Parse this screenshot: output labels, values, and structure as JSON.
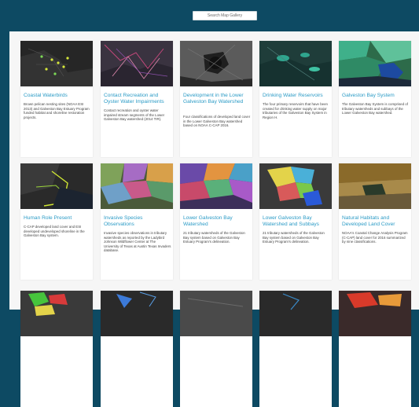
{
  "search": {
    "placeholder": "Search Map Gallery"
  },
  "colors": {
    "header": "#0d4a63",
    "panel": "#f6f6f6",
    "title_link": "#2b9bc6"
  },
  "cards": [
    {
      "title": "Coastal Waterbirds",
      "desc": "Brown pelican nesting sites (NOAA ESI 2013) and Galveston Bay Estuary Program funded habitat and shoreline restoration projects."
    },
    {
      "title": "Contact Recreation and Oyster Water Impairments",
      "desc": "Contact recreation and oyster water impaired stream segments of the Lower Galveston Bay watershed (2014 TIR)."
    },
    {
      "title": "Development in the Lower Galveston Bay Watershed",
      "desc": "Four classifications of developed land cover in the Lower Galveston Bay watershed based on NOAA C-CAP 2016."
    },
    {
      "title": "Drinking Water Reservoirs",
      "desc": "The four primary reservoirs that have been created for drinking water supply on major tributaries of the Galveston Bay System in Region H."
    },
    {
      "title": "Galveston Bay System",
      "desc": "The Galveston Bay System is comprised of tributary watersheds and subbays of the Lower Galveston Bay watershed."
    },
    {
      "title": "Human Role Present",
      "desc": "C-CAP developed land cover and ESI developed undeveloped shoreline in the Galveston Bay system."
    },
    {
      "title": "Invasive Species Observations",
      "desc": "Invasive species observations in tributary watersheds as reported by the Ladybird Johnson Wildflower Center at The University of Texas at Austin Texas Invaders database."
    },
    {
      "title": "Lower Galveston Bay Watershed",
      "desc": "21 tributary watersheds of the Galveston Bay system based on Galveston Bay Estuary Program's delineation."
    },
    {
      "title": "Lower Galveston Bay Watershed and Subbays",
      "desc": "21 tributary watersheds of the Galveston Bay system based on Galveston Bay Estuary Program's delineation."
    },
    {
      "title": "Natural Habitats and Developed Land Cover",
      "desc": "NOAA's Coastal Change Analysis Program (C-CAP) land cover for 2016 summarized by nine classifications."
    }
  ],
  "thumbs": [
    {
      "icon": "coastal-waterbirds-map-thumbnail",
      "base": "#262626",
      "accent": "#d6e83b"
    },
    {
      "icon": "contact-recreation-map-thumbnail",
      "base": "#3a3340",
      "accent": "#c2477a"
    },
    {
      "icon": "development-map-thumbnail",
      "base": "#5b5b5b",
      "accent": "#1f1f1f"
    },
    {
      "icon": "drinking-water-reservoirs-map-thumbnail",
      "base": "#1f3d3a",
      "accent": "#2fa58e"
    },
    {
      "icon": "galveston-bay-system-map-thumbnail",
      "base": "#2d6b4a",
      "accent": "#3fb08a"
    },
    {
      "icon": "human-role-present-map-thumbnail",
      "base": "#2a2a2a",
      "accent": "#cfe633"
    },
    {
      "icon": "invasive-species-map-thumbnail",
      "base": "#4a5a3a",
      "accent": "#a66cc4"
    },
    {
      "icon": "lower-galveston-bay-watershed-map-thumbnail",
      "base": "#3c2f5a",
      "accent": "#e39440"
    },
    {
      "icon": "watershed-and-subbays-map-thumbnail",
      "base": "#3a3a3a",
      "accent": "#e3d34a"
    },
    {
      "icon": "natural-habitats-map-thumbnail",
      "base": "#5c4a2a",
      "accent": "#8a6a2a"
    },
    {
      "icon": "row3-thumbnail-1",
      "base": "#3a3a3a",
      "accent": "#46c43c"
    },
    {
      "icon": "row3-thumbnail-2",
      "base": "#2a2a2a",
      "accent": "#3c7ad8"
    },
    {
      "icon": "row3-thumbnail-3",
      "base": "#4a4a4a",
      "accent": "#6a6a6a"
    },
    {
      "icon": "row3-thumbnail-4",
      "base": "#2a2a2a",
      "accent": "#3a8ac8"
    },
    {
      "icon": "row3-thumbnail-5",
      "base": "#3a2a2a",
      "accent": "#d83a2a"
    }
  ]
}
